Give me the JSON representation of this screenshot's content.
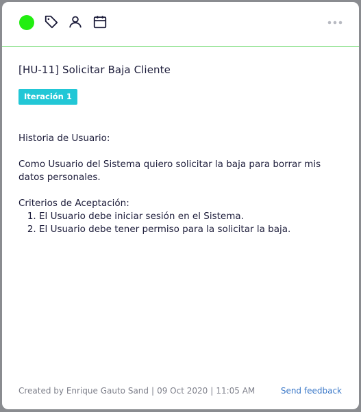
{
  "colors": {
    "status": "#22ee11",
    "badge": "#22c7d6",
    "divider": "#5ad35a",
    "link": "#3a78c8"
  },
  "toolbar": {
    "icons": [
      "status-dot",
      "tag-icon",
      "user-icon",
      "calendar-icon",
      "more-icon"
    ]
  },
  "card": {
    "title": "[HU-11] Solicitar Baja Cliente",
    "badge": "Iteración 1",
    "description": {
      "heading": "Historia de Usuario:",
      "story": "Como Usuario del Sistema quiero solicitar la baja para borrar mis datos personales.",
      "criteria_heading": "Criterios de Aceptación:",
      "criteria": [
        "El Usuario debe iniciar sesión en el Sistema.",
        "El Usuario debe tener permiso para la solicitar la baja."
      ]
    }
  },
  "footer": {
    "created_by": "Created by Enrique Gauto Sand",
    "date": "09 Oct 2020",
    "time": "11:05 AM",
    "feedback": "Send feedback"
  }
}
